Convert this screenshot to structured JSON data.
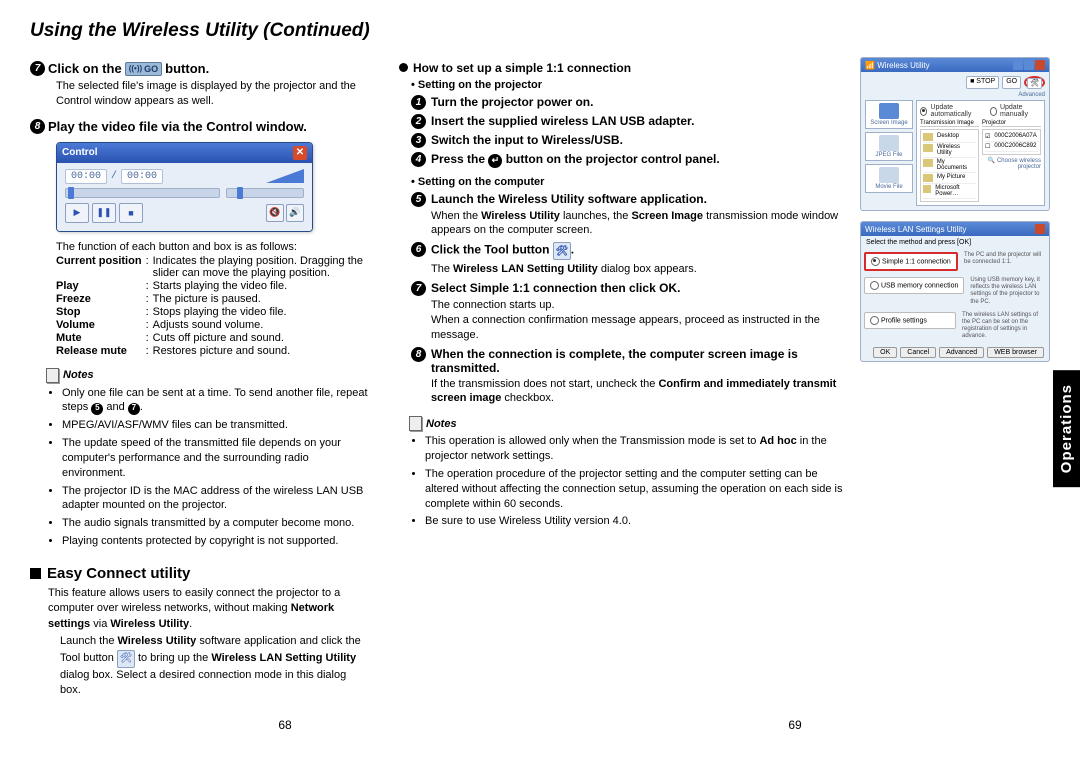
{
  "header": {
    "title": "Using the Wireless Utility (Continued)"
  },
  "left": {
    "step7": {
      "num": "7",
      "pre": "Click on the",
      "btn_ant": "((•))",
      "btn_go": "GO",
      "post": "button.",
      "body": "The selected file's image is displayed by the projector and the Control window appears as well."
    },
    "step8": {
      "num": "8",
      "title": "Play the video file via the Control window."
    },
    "cw": {
      "title": "Control",
      "time1": "00:00",
      "sep": "/",
      "time2": "00:00"
    },
    "def_intro": "The function of each button and box is as follows:",
    "defs": [
      {
        "k": "Current position",
        "c": ":",
        "v": "Indicates the playing position. Dragging the slider can move the playing position."
      },
      {
        "k": "Play",
        "c": ":",
        "v": "Starts playing the video file."
      },
      {
        "k": "Freeze",
        "c": ":",
        "v": "The picture is paused."
      },
      {
        "k": "Stop",
        "c": ":",
        "v": "Stops playing the video file."
      },
      {
        "k": "Volume",
        "c": ":",
        "v": "Adjusts sound volume."
      },
      {
        "k": "Mute",
        "c": ":",
        "v": "Cuts off picture and sound."
      },
      {
        "k": "Release mute",
        "c": ":",
        "v": "Restores picture and sound."
      }
    ],
    "notes_head": "Notes",
    "notes": [
      {
        "pre": "Only one file can be sent at a time. To send another file, repeat steps ",
        "mid1": "5",
        "mid2": " and ",
        "mid3": "7",
        "post": "."
      },
      {
        "t": "MPEG/AVI/ASF/WMV files can be transmitted."
      },
      {
        "t": "The update speed of the transmitted file depends on your computer's performance and the surrounding radio environment."
      },
      {
        "t": "The projector ID is the MAC address of the wireless LAN USB adapter mounted on the projector."
      },
      {
        "t": "The audio signals transmitted by a computer become mono."
      },
      {
        "t": "Playing contents protected by copyright is not supported."
      }
    ],
    "easy": {
      "title": "Easy Connect utility",
      "p1_a": "This feature allows users to easily connect the projector to a computer over wireless networks, without making ",
      "p1_b": "Network settings",
      "p1_c": " via ",
      "p1_d": "Wireless Utility",
      "p1_e": ".",
      "p2_a": "Launch the ",
      "p2_b": "Wireless Utility",
      "p2_c": " software application and click the Tool button ",
      "p2_d": " to bring up the ",
      "p2_e": "Wireless LAN Setting Utility",
      "p2_f": " dialog box. Select a desired connection mode in this dialog box."
    }
  },
  "right": {
    "h1": "How to set up a simple 1:1 connection",
    "sub_proj": "Setting on the projector",
    "s1": {
      "n": "1",
      "t": "Turn the projector power on."
    },
    "s2": {
      "n": "2",
      "t": "Insert the supplied wireless LAN USB adapter."
    },
    "s3": {
      "n": "3",
      "t": "Switch the input to Wireless/USB."
    },
    "s4": {
      "n": "4",
      "pre": "Press the ",
      "post": " button on the projector control panel."
    },
    "sub_comp": "Setting on the computer",
    "s5": {
      "n": "5",
      "t": "Launch the Wireless Utility software application.",
      "body_a": "When the ",
      "body_b": "Wireless Utility",
      "body_c": " launches, the ",
      "body_d": "Screen Image",
      "body_e": " transmission mode window appears on the computer screen."
    },
    "s6": {
      "n": "6",
      "pre": "Click the Tool button ",
      "post": ".",
      "body_a": "The ",
      "body_b": "Wireless LAN Setting Utility",
      "body_c": " dialog box appears."
    },
    "s7": {
      "n": "7",
      "t": "Select Simple 1:1 connection then click OK.",
      "body": "The connection starts up.\nWhen a connection confirmation message appears, proceed as instructed in the message."
    },
    "s8": {
      "n": "8",
      "t": "When the connection is complete, the computer screen image is transmitted.",
      "body_a": "If the transmission does not start, uncheck the ",
      "body_b": "Confirm and immediately transmit screen image",
      "body_c": " checkbox."
    },
    "notes_head": "Notes",
    "notes": [
      {
        "a": "This operation is allowed only when the Transmission mode is set to ",
        "b": "Ad hoc",
        "c": " in the projector network settings."
      },
      {
        "a": "The operation procedure of the projector setting and the computer setting can be altered without affecting the connection setup, assuming the operation on each side is complete within 60 seconds."
      },
      {
        "a": "Be sure to use Wireless Utility version 4.0."
      }
    ],
    "fig1": {
      "title": "Wireless Utility",
      "stop": "STOP",
      "go": "GO",
      "adv": "Advanced",
      "thumbs": [
        "Screen Image",
        "JPEG File",
        "Movie File"
      ],
      "radio1": "Update automatically",
      "radio2": "Update manually",
      "panelL": "Transmission Image",
      "panelR": "Projector",
      "items": [
        "Desktop",
        "Wireless Utility",
        "My Documents",
        "My Picture",
        "Microsoft Power…"
      ],
      "addrs": [
        "000C2006A07A",
        "000C2006C892"
      ],
      "choose": "Choose wireless projector"
    },
    "fig2": {
      "title": "Wireless LAN Settings Utility",
      "intro": "Select the method and press [OK]",
      "opt1": "Simple 1:1 connection",
      "opt1d": "The PC and the projector will be connected 1:1.",
      "opt2": "USB memory connection",
      "opt2d": "Using USB memory key, it reflects the wireless LAN settings of the projector to the PC.",
      "opt3": "Profile settings",
      "opt3d": "The wireless LAN settings of the PC can be set on the registration of settings in advance.",
      "btns": [
        "OK",
        "Cancel",
        "Advanced",
        "WEB browser"
      ]
    }
  },
  "side_tab": "Operations",
  "page_left": "68",
  "page_right": "69"
}
